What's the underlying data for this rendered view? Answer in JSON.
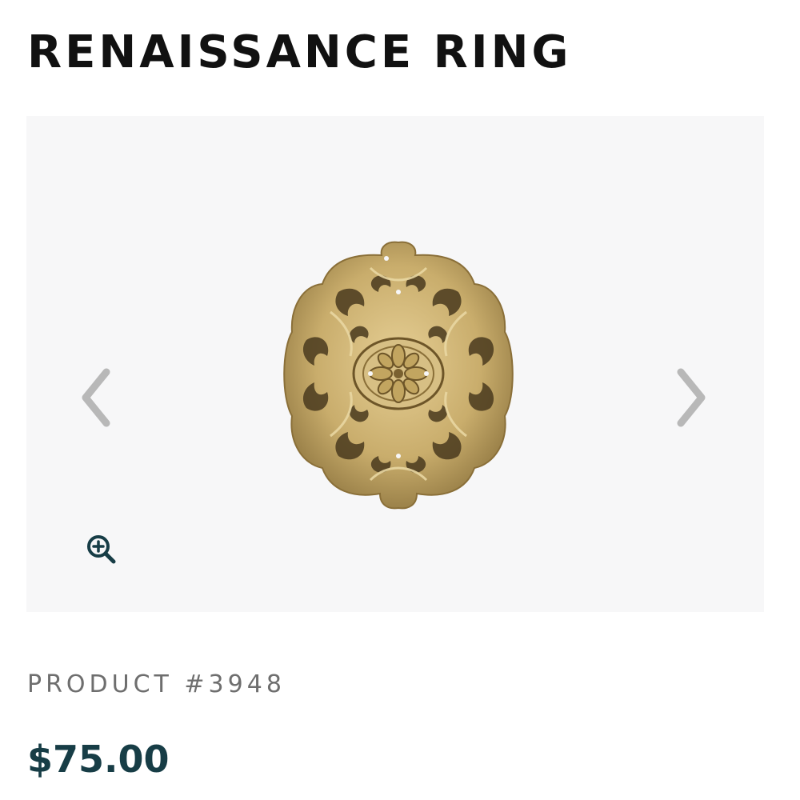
{
  "product": {
    "title": "RENAISSANCE RING",
    "product_number": "PRODUCT #3948",
    "price": "$75.00"
  },
  "gallery": {
    "icons": {
      "prev": "chevron-left-icon",
      "next": "chevron-right-icon",
      "zoom": "zoom-in-icon"
    }
  },
  "colors": {
    "title": "#111111",
    "product_number": "#6e6e6e",
    "price": "#173d46",
    "gallery_background": "#f7f7f8",
    "arrow": "#b8b8b8",
    "zoom_icon": "#173d46",
    "ring_gold": "#c9ad6c"
  }
}
